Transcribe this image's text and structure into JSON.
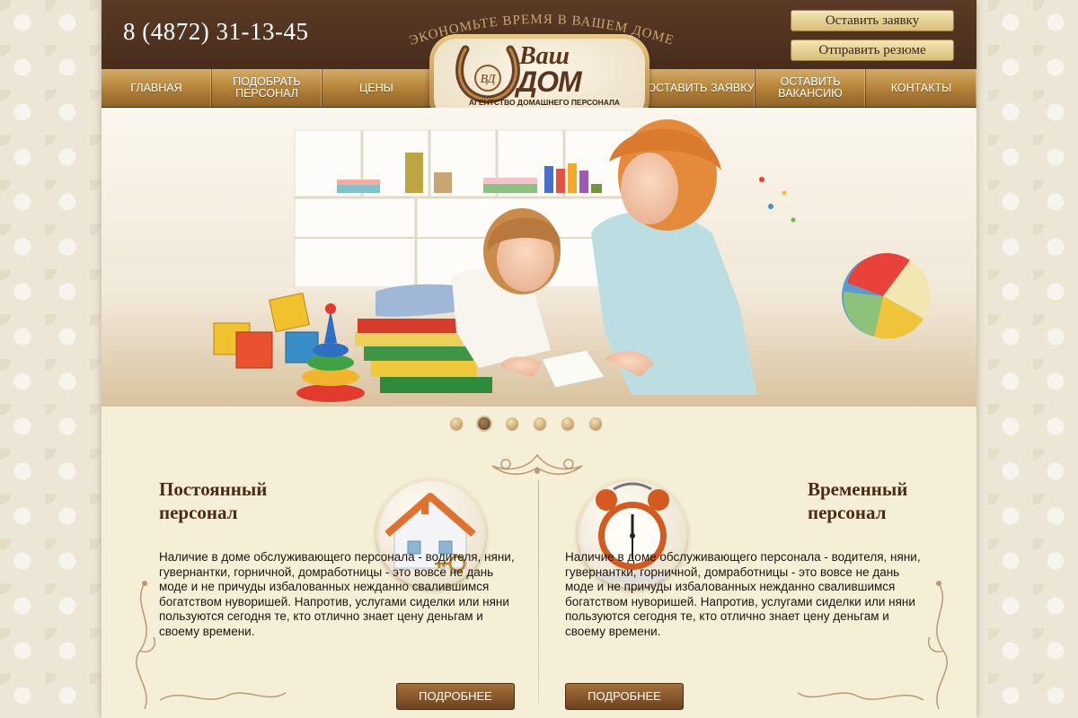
{
  "header": {
    "phone": "8 (4872) 31-13-45",
    "slogan": "ЭКОНОМЬТЕ ВРЕМЯ В ВАШЕМ ДОМЕ",
    "top_buttons": [
      "Оставить заявку",
      "Отправить резюме"
    ]
  },
  "logo": {
    "word1": "Ваш",
    "word2": "ДОМ",
    "monogram": "ВД",
    "subtitle": "АГЕНТСТВО ДОМАШНЕГО ПЕРСОНАЛА"
  },
  "nav": {
    "items": [
      {
        "label": "ГЛАВНАЯ"
      },
      {
        "label": "ПОДОБРАТЬ ПЕРСОНАЛ"
      },
      {
        "label": "ЦЕНЫ"
      },
      {
        "label": "ОСТАВИТЬ ЗАЯВКУ"
      },
      {
        "label": "ОСТАВИТЬ ВАКАНСИЮ"
      },
      {
        "label": "КОНТАКТЫ"
      }
    ]
  },
  "slider": {
    "active_index": 1,
    "count": 6
  },
  "columns": {
    "left": {
      "title_line1": "Постоянный",
      "title_line2": "персонал",
      "text": "Наличие в доме обслуживающего персонала - водителя, няни, гувернантки, горничной, домработницы - это вовсе не дань моде и не причуды избалованных нежданно свалившимся богатством нуворишей. Напротив, услугами сиделки или няни пользуются сегодня те, кто отлично знает цену деньгам и своему времени.",
      "button": "ПОДРОБНЕЕ"
    },
    "right": {
      "title_line1": "Временный",
      "title_line2": "персонал",
      "text": "Наличие в доме обслуживающего персонала - водителя, няни, гувернантки, горничной, домработницы - это вовсе не дань моде и не причуды избалованных нежданно свалившимся богатством нуворишей. Напротив, услугами сиделки или няни пользуются сегодня те, кто отлично знает цену деньгам и своему времени.",
      "button": "ПОДРОБНЕЕ"
    }
  },
  "colors": {
    "header_brown": "#4a2f1d",
    "gold": "#c9a05a",
    "cream": "#f6efd8"
  }
}
